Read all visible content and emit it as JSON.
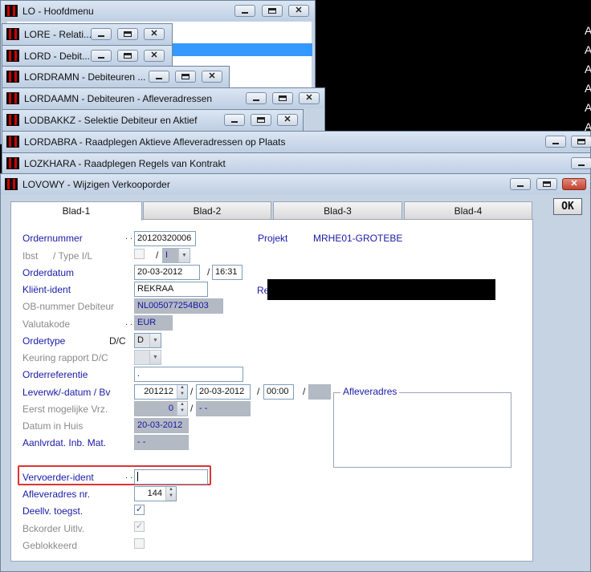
{
  "windows": {
    "main": {
      "title": "LO - Hoofdmenu"
    },
    "lore": {
      "title": "LORE - Relati..."
    },
    "lord": {
      "title": "LORD - Debit..."
    },
    "lordramn": {
      "title": "LORDRAMN - Debiteuren ..."
    },
    "lordaamn": {
      "title": "LORDAAMN - Debiteuren  -  Afleveradressen"
    },
    "lodbakkz": {
      "title": "LODBAKKZ - Selektie Debiteur en Aktief"
    },
    "lordabra": {
      "title": "LORDABRA - Raadplegen Aktieve Afleveradressen op Plaats"
    },
    "lozkhara": {
      "title": "LOZKHARA - Raadplegen Regels van Kontrakt"
    },
    "lovowy": {
      "title": "LOVOWY - Wijzigen Verkooporder"
    }
  },
  "edge_glyph": "A",
  "tabs": [
    "Blad-1",
    "Blad-2",
    "Blad-3",
    "Blad-4"
  ],
  "ok_label": "OK",
  "form": {
    "ordernummer": {
      "label": "Ordernummer",
      "value": "20120320006"
    },
    "projekt": {
      "label": "Projekt",
      "value": "MRHE01-GROTEBE"
    },
    "ibst": {
      "label": "Ibst",
      "type_label": "/ Type I/L",
      "type_value": "I"
    },
    "orderdatum": {
      "label": "Orderdatum",
      "date": "20-03-2012",
      "time": "16:31"
    },
    "klient": {
      "label": "Kliënt-ident",
      "value": "REKRAA",
      "ref_label": "Re"
    },
    "ob_nummer": {
      "label": "OB-nummer Debiteur",
      "value": "NL005077254B03"
    },
    "valutakode": {
      "label": "Valutakode",
      "value": "EUR"
    },
    "ordertype": {
      "label": "Ordertype",
      "dc": "D/C",
      "value": "D"
    },
    "keuring": {
      "label": "Keuring rapport D/C"
    },
    "orderreferentie": {
      "label": "Orderreferentie",
      "value": "."
    },
    "leverwk": {
      "label": "Leverwk/-datum / Bv",
      "week": "201212",
      "date": "20-03-2012",
      "time": "00:00"
    },
    "afleveradres_group": "Afleveradres",
    "eerst": {
      "label": "Eerst mogelijke Vrz.",
      "value": "0",
      "date": "- -"
    },
    "datum_in_huis": {
      "label": "Datum in Huis",
      "value": "20-03-2012"
    },
    "aanlvrdat": {
      "label": "Aanlvrdat. Inb. Mat.",
      "value": "- -"
    },
    "vervoerder": {
      "label": "Vervoerder-ident",
      "value": ""
    },
    "afleveradres_nr": {
      "label": "Afleveradres nr.",
      "value": "144"
    },
    "deellv": {
      "label": "Deellv. toegst.",
      "checked": true
    },
    "backorder": {
      "label": "Bckorder Uitlv.",
      "checked": true
    },
    "geblokkeerd": {
      "label": "Geblokkeerd",
      "checked": false
    }
  }
}
